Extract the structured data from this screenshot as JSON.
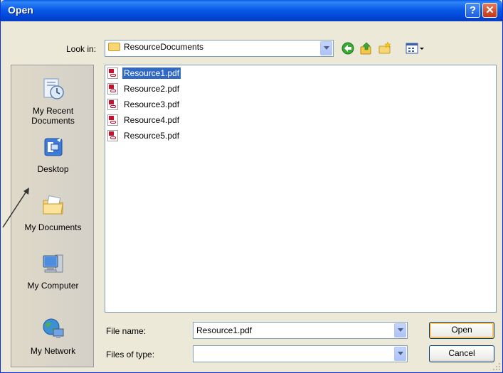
{
  "window": {
    "title": "Open",
    "help_label": "?",
    "close_label": "✕"
  },
  "toolbar": {
    "lookin_label": "Look in:",
    "lookin_value": "ResourceDocuments",
    "icons": [
      "back-icon",
      "up-folder-icon",
      "new-folder-icon",
      "views-menu-icon"
    ]
  },
  "places": [
    {
      "label": "My Recent\nDocuments",
      "line1": "My Recent",
      "line2": "Documents",
      "icon": "recent-documents-icon"
    },
    {
      "label": "Desktop",
      "icon": "desktop-icon"
    },
    {
      "label": "My Documents",
      "icon": "my-documents-icon"
    },
    {
      "label": "My Computer",
      "icon": "my-computer-icon"
    },
    {
      "label": "My Network",
      "icon": "my-network-icon"
    }
  ],
  "files": [
    {
      "name": "Resource1.pdf",
      "selected": true
    },
    {
      "name": "Resource2.pdf",
      "selected": false
    },
    {
      "name": "Resource3.pdf",
      "selected": false
    },
    {
      "name": "Resource4.pdf",
      "selected": false
    },
    {
      "name": "Resource5.pdf",
      "selected": false
    }
  ],
  "filename": {
    "label": "File name:",
    "value": "Resource1.pdf"
  },
  "filetype": {
    "label": "Files of type:",
    "value": ""
  },
  "buttons": {
    "open": "Open",
    "cancel": "Cancel"
  },
  "colors": {
    "title_bar": "#0a5ae9",
    "selection": "#316ac5",
    "dialog_bg": "#ece9d8"
  }
}
